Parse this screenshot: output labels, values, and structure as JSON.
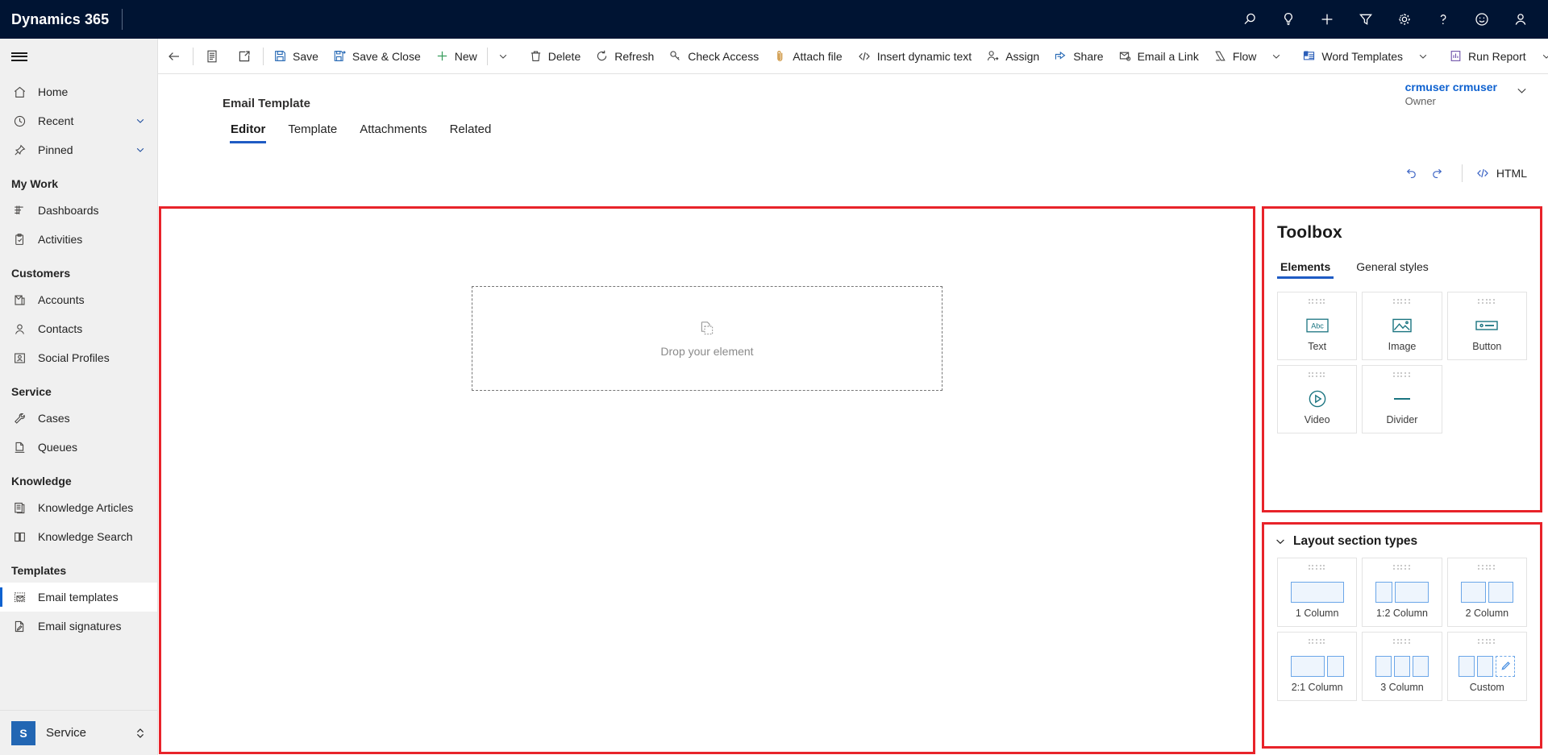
{
  "header": {
    "brand": "Dynamics 365",
    "icons": [
      {
        "name": "search-icon",
        "label": "Search"
      },
      {
        "name": "lightbulb-icon",
        "label": "Ideas"
      },
      {
        "name": "plus-icon",
        "label": "Quick create"
      },
      {
        "name": "filter-icon",
        "label": "Filter"
      },
      {
        "name": "gear-icon",
        "label": "Settings"
      },
      {
        "name": "question-icon",
        "label": "Help"
      },
      {
        "name": "smiley-icon",
        "label": "Feedback"
      },
      {
        "name": "person-icon",
        "label": "Account manager"
      }
    ]
  },
  "sidebar": {
    "hamburger_label": "Site map",
    "items": [
      {
        "label": "Home",
        "icon": "home-icon",
        "type": "item"
      },
      {
        "label": "Recent",
        "icon": "clock-icon",
        "type": "item",
        "chevron": true
      },
      {
        "label": "Pinned",
        "icon": "pin-icon",
        "type": "item",
        "chevron": true
      },
      {
        "label": "My Work",
        "type": "group"
      },
      {
        "label": "Dashboards",
        "icon": "dashboard-icon",
        "type": "item"
      },
      {
        "label": "Activities",
        "icon": "activities-icon",
        "type": "item"
      },
      {
        "label": "Customers",
        "type": "group"
      },
      {
        "label": "Accounts",
        "icon": "accounts-icon",
        "type": "item"
      },
      {
        "label": "Contacts",
        "icon": "contact-icon",
        "type": "item"
      },
      {
        "label": "Social Profiles",
        "icon": "social-profile-icon",
        "type": "item"
      },
      {
        "label": "Service",
        "type": "group"
      },
      {
        "label": "Cases",
        "icon": "case-icon",
        "type": "item"
      },
      {
        "label": "Queues",
        "icon": "queue-icon",
        "type": "item"
      },
      {
        "label": "Knowledge",
        "type": "group"
      },
      {
        "label": "Knowledge Articles",
        "icon": "knowledge-article-icon",
        "type": "item"
      },
      {
        "label": "Knowledge Search",
        "icon": "knowledge-search-icon",
        "type": "item"
      },
      {
        "label": "Templates",
        "type": "group"
      },
      {
        "label": "Email templates",
        "icon": "email-template-icon",
        "type": "item",
        "selected": true
      },
      {
        "label": "Email signatures",
        "icon": "email-signature-icon",
        "type": "item"
      }
    ],
    "footer": {
      "app_initial": "S",
      "app_name": "Service"
    }
  },
  "command_bar": {
    "items": [
      {
        "label": "",
        "icon": "back-arrow-icon",
        "kind": "icon"
      },
      {
        "label": "",
        "icon": "form-icon",
        "kind": "icon"
      },
      {
        "label": "",
        "icon": "popout-icon",
        "kind": "icon"
      },
      {
        "label": "Save",
        "icon": "save-icon",
        "kind": "button"
      },
      {
        "label": "Save & Close",
        "icon": "save-close-icon",
        "kind": "button"
      },
      {
        "label": "New",
        "icon": "plus-icon",
        "kind": "button"
      },
      {
        "label": "",
        "icon": "chevron-down-icon",
        "kind": "chevron"
      },
      {
        "label": "Delete",
        "icon": "trash-icon",
        "kind": "button"
      },
      {
        "label": "Refresh",
        "icon": "refresh-icon",
        "kind": "button"
      },
      {
        "label": "Check Access",
        "icon": "key-icon",
        "kind": "button"
      },
      {
        "label": "Attach file",
        "icon": "paperclip-icon",
        "kind": "button"
      },
      {
        "label": "Insert dynamic text",
        "icon": "code-icon",
        "kind": "button"
      },
      {
        "label": "Assign",
        "icon": "assign-icon",
        "kind": "button"
      },
      {
        "label": "Share",
        "icon": "share-icon",
        "kind": "button"
      },
      {
        "label": "Email a Link",
        "icon": "email-link-icon",
        "kind": "button"
      },
      {
        "label": "Flow",
        "icon": "flow-icon",
        "kind": "button"
      },
      {
        "label": "",
        "icon": "chevron-down-icon",
        "kind": "chevron"
      },
      {
        "label": "Word Templates",
        "icon": "word-template-icon",
        "kind": "button"
      },
      {
        "label": "",
        "icon": "chevron-down-icon",
        "kind": "chevron"
      },
      {
        "label": "Run Report",
        "icon": "run-report-icon",
        "kind": "button"
      },
      {
        "label": "",
        "icon": "chevron-down-icon",
        "kind": "chevron"
      }
    ]
  },
  "record": {
    "title": "Email Template",
    "owner_name": "crmuser crmuser",
    "owner_role": "Owner",
    "tabs": [
      {
        "label": "Editor",
        "active": true
      },
      {
        "label": "Template",
        "active": false
      },
      {
        "label": "Attachments",
        "active": false
      },
      {
        "label": "Related",
        "active": false
      }
    ]
  },
  "editor_tools": {
    "undo_label": "Undo",
    "redo_label": "Redo",
    "html_label": "HTML"
  },
  "canvas": {
    "dropzone_text": "Drop your element",
    "dropzone_icon": "drop-element-icon"
  },
  "toolbox": {
    "title": "Toolbox",
    "tabs": [
      {
        "label": "Elements",
        "active": true
      },
      {
        "label": "General styles",
        "active": false
      }
    ],
    "elements": [
      {
        "label": "Text",
        "icon": "text-element-icon"
      },
      {
        "label": "Image",
        "icon": "image-element-icon"
      },
      {
        "label": "Button",
        "icon": "button-element-icon"
      },
      {
        "label": "Video",
        "icon": "video-element-icon"
      },
      {
        "label": "Divider",
        "icon": "divider-element-icon"
      }
    ]
  },
  "layout_section": {
    "title": "Layout section types",
    "expanded": true,
    "items": [
      {
        "label": "1 Column",
        "layout": "full"
      },
      {
        "label": "1:2 Column",
        "layout": "1-2"
      },
      {
        "label": "2 Column",
        "layout": "half-half"
      },
      {
        "label": "2:1 Column",
        "layout": "2-1"
      },
      {
        "label": "3 Column",
        "layout": "thirds"
      },
      {
        "label": "Custom",
        "layout": "custom"
      }
    ]
  },
  "colors": {
    "header_bg": "#001433",
    "accent_blue": "#1f5bc4",
    "link_blue": "#0f62d0",
    "highlight_red": "#e8232a",
    "element_icon_teal": "#1a7480",
    "layout_preview_blue": "#6ba6e8",
    "sidebar_bg": "#f0f0f0",
    "app_square_blue": "#2266b3"
  }
}
